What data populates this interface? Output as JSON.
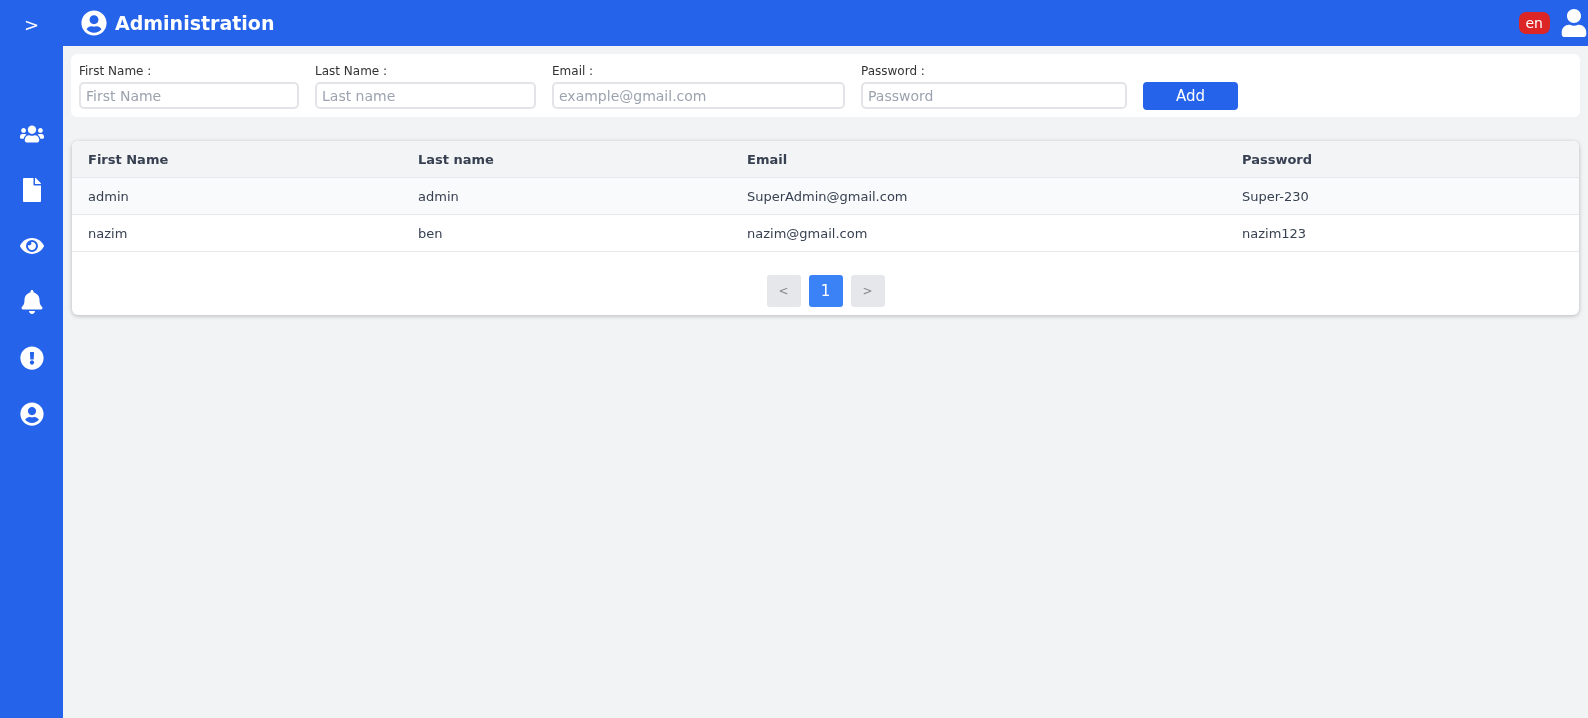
{
  "header": {
    "title": "Administration",
    "language": "en"
  },
  "sidebar": {
    "toggle": ">",
    "items": [
      {
        "kind": "users"
      },
      {
        "kind": "file"
      },
      {
        "kind": "eye"
      },
      {
        "kind": "bell"
      },
      {
        "kind": "alert"
      },
      {
        "kind": "user"
      }
    ]
  },
  "form": {
    "fields": [
      {
        "label": "First Name :",
        "placeholder": "First Name"
      },
      {
        "label": "Last Name :",
        "placeholder": "Last name"
      },
      {
        "label": "Email :",
        "placeholder": "example@gmail.com"
      },
      {
        "label": "Password :",
        "placeholder": "Password"
      }
    ],
    "button": "Add"
  },
  "table": {
    "columns": [
      "First Name",
      "Last name",
      "Email",
      "Password"
    ],
    "rows": [
      [
        "admin",
        "admin",
        "SuperAdmin@gmail.com",
        "Super-230"
      ],
      [
        "nazim",
        "ben",
        "nazim@gmail.com",
        "nazim123"
      ]
    ]
  },
  "pagination": {
    "prev": "<",
    "pages": [
      {
        "label": "1",
        "selected": true
      }
    ],
    "next": ">"
  }
}
